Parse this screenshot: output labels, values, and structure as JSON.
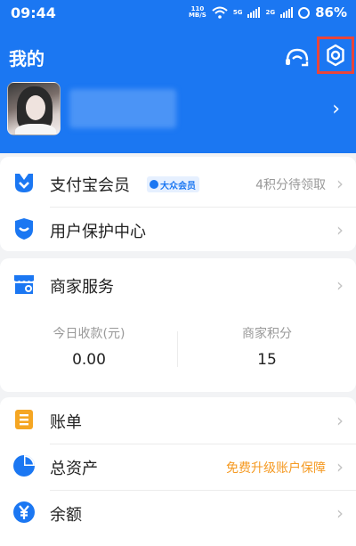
{
  "status_bar": {
    "time": "09:44",
    "net_speed_value": "110",
    "net_speed_unit": "MB/S",
    "sim1": "5G",
    "sim2": "2G",
    "battery": "86%"
  },
  "header": {
    "title": "我的",
    "icons": [
      "helmet-support-icon",
      "gear-icon"
    ]
  },
  "profile": {
    "chevron": "›"
  },
  "card1": {
    "rows": [
      {
        "label": "支付宝会员",
        "badge": "大众会员",
        "extra": "4积分待领取",
        "icon": "member-icon"
      },
      {
        "label": "用户保护中心",
        "icon": "shield-icon"
      }
    ]
  },
  "card2": {
    "title": "商家服务",
    "icon": "shop-icon",
    "stats": [
      {
        "label": "今日收款(元)",
        "value": "0.00"
      },
      {
        "label": "商家积分",
        "value": "15"
      }
    ]
  },
  "card3": {
    "rows": [
      {
        "label": "账单",
        "icon": "bill-icon"
      },
      {
        "label": "总资产",
        "extra": "免费升级账户保障",
        "icon": "pie-chart-icon"
      },
      {
        "label": "余额",
        "icon": "yuan-icon"
      }
    ]
  },
  "chevron": "›",
  "colors": {
    "brand_blue": "#1b77f2",
    "highlight_red": "#e9453a",
    "bill_orange": "#f5a623",
    "extra_orange": "#f59a23"
  }
}
